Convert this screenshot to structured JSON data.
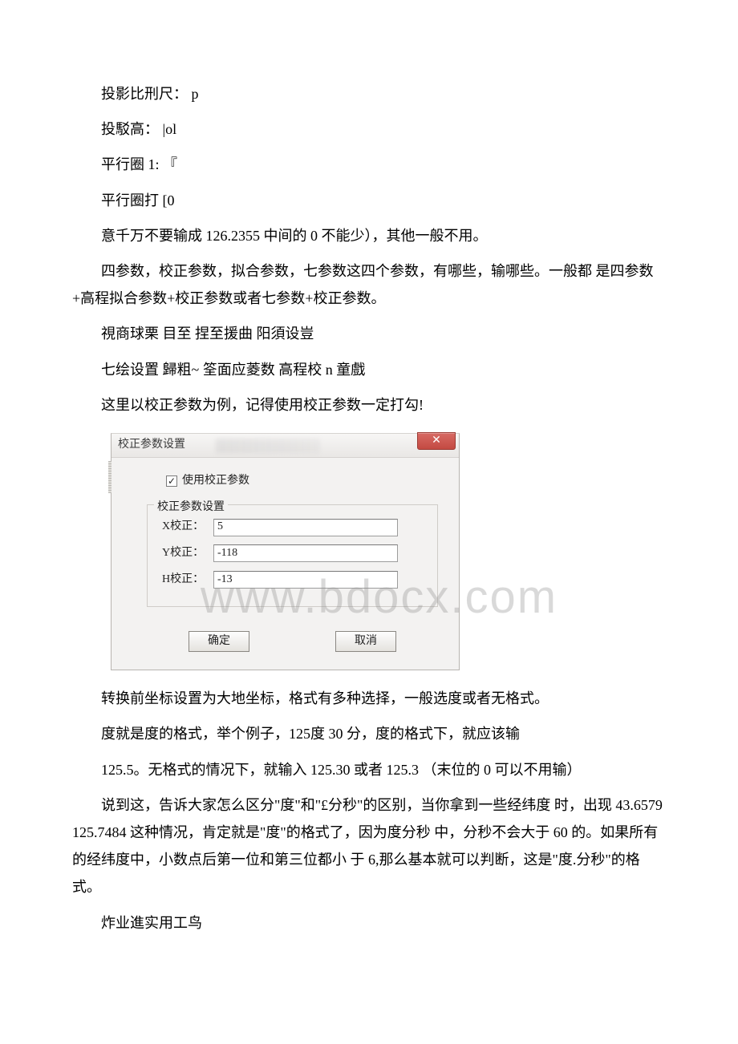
{
  "paragraphs": {
    "p1": "投影比刑尺： p",
    "p2": "投駁高： |ol",
    "p3": "平行圈 1: 『",
    "p4": "平行圈打 [0",
    "p5": "意千万不要输成 126.2355 中间的 0 不能少），其他一般不用。",
    "p6": "四参数，校正参数，拟合参数，七参数这四个参数，有哪些，输哪些。一般都 是四参数+高程拟合参数+校正参数或者七参数+校正参数。",
    "p7": "視商球栗 目至 捏至援曲 阳須设豈",
    "p8": "七绘设置 歸粗~ 筌面应菱数 高程校 n 童戲",
    "p9": "这里以校正参数为例，记得使用校正参数一定打勾!",
    "p10": "转换前坐标设置为大地坐标，格式有多种选择，一般选度或者无格式。",
    "p11": "度就是度的格式，举个例子，125度 30 分，度的格式下，就应该输",
    "p12": "125.5。无格式的情况下，就输入 125.30 或者 125.3 （末位的 0 可以不用输）",
    "p13": "说到这，告诉大家怎么区分\"度\"和\"£分秒\"的区别，当你拿到一些经纬度 时，出现 43.6579 125.7484 这种情况，肯定就是\"度\"的格式了，因为度分秒 中，分秒不会大于 60 的。如果所有的经纬度中，小数点后第一位和第三位都小 于 6,那么基本就可以判断，这是\"度.分秒\"的格式。",
    "p14": "炸业進实用工鸟"
  },
  "dialog": {
    "title": "校正参数设置",
    "close_glyph": "✕",
    "checkbox_label": "使用校正参数",
    "checkbox_mark": "✓",
    "group_title": "校正参数设置",
    "fields": {
      "x_label": "X校正：",
      "x_value": "5",
      "y_label": "Y校正：",
      "y_value": "-118",
      "h_label": "H校正：",
      "h_value": "-13"
    },
    "ok_label": "确定",
    "cancel_label": "取消"
  },
  "watermark": "www.bdocx.com"
}
